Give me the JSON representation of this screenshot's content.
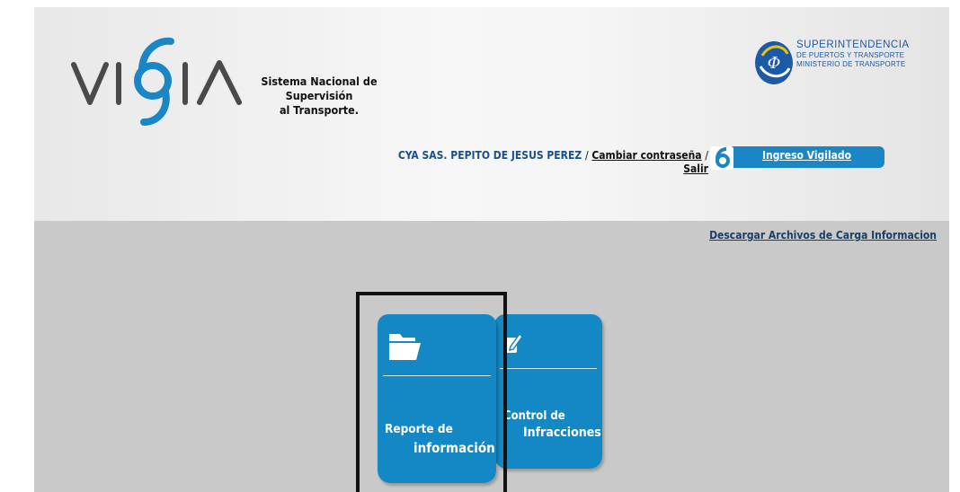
{
  "header": {
    "logo_text": "VIGIA",
    "system_name_line1": "Sistema Nacional de Supervisión",
    "system_name_line2": "al Transporte.",
    "super_logo": {
      "line1": "SUPERINTENDENCIA",
      "line2": "DE PUERTOS Y TRANSPORTE",
      "line3": "MINISTERIO DE TRANSPORTE"
    }
  },
  "userbar": {
    "user": "CYA SAS. PEPITO DE JESUS PEREZ",
    "separator": "/",
    "change_password": "Cambiar contraseña",
    "logout": "Salir",
    "ingreso_label": "Ingreso Vigilado"
  },
  "content": {
    "download_link": "Descargar Archivos de Carga Informacion",
    "tiles": [
      {
        "line1": "Reporte de",
        "line2": "información",
        "icon": "folder-icon"
      },
      {
        "line1": "Control de",
        "line2": "Infracciones",
        "icon": "edit-icon"
      }
    ]
  },
  "colors": {
    "tile_blue": "#1488c4",
    "content_bg": "#c9c9c9",
    "brand_blue": "#1b86c6"
  }
}
